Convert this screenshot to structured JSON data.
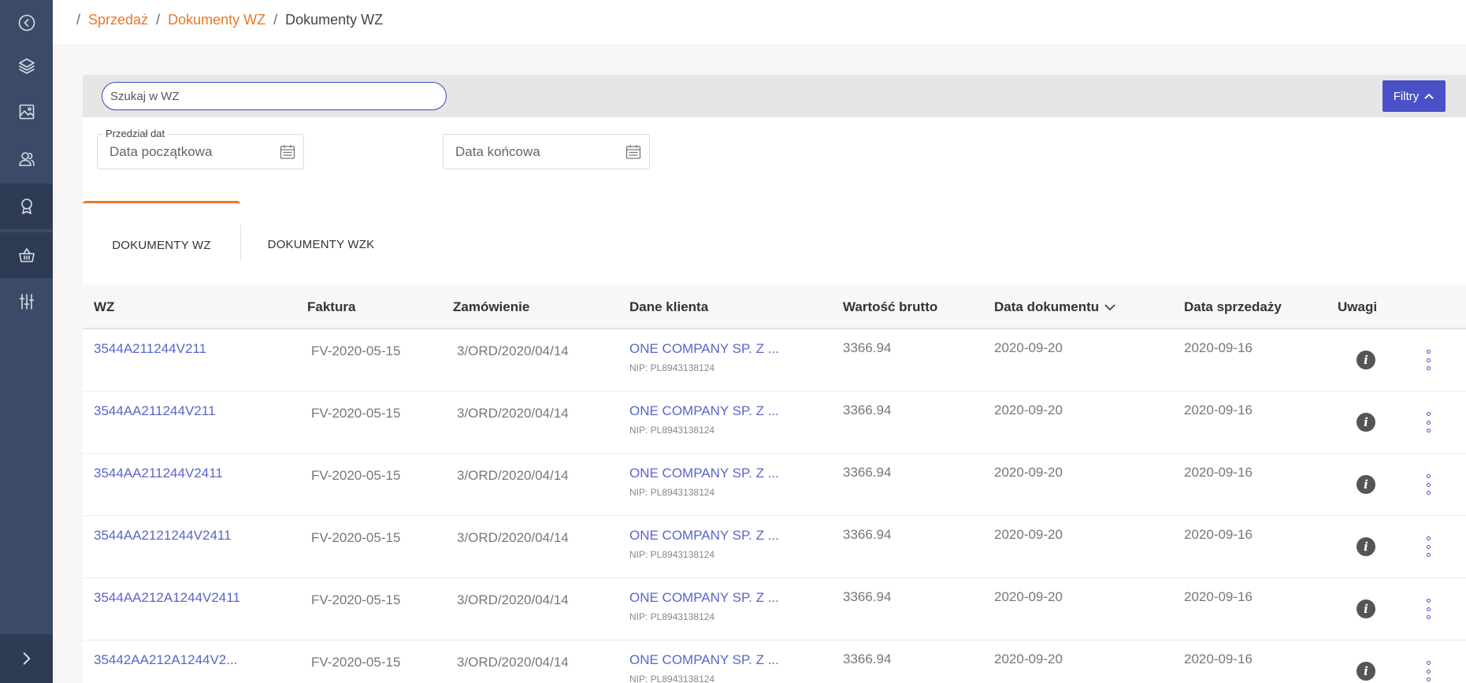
{
  "sidebar": {
    "items": [
      {
        "icon": "back-circle-icon"
      },
      {
        "icon": "layers-icon"
      },
      {
        "icon": "image-icon"
      },
      {
        "icon": "users-icon"
      },
      {
        "icon": "award-icon"
      },
      {
        "icon": "basket-icon"
      },
      {
        "icon": "sliders-icon"
      }
    ],
    "expand_icon": "chevron-right-icon"
  },
  "breadcrumb": {
    "items": [
      "Sprzedaż",
      "Dokumenty WZ",
      "Dokumenty WZ"
    ]
  },
  "search": {
    "placeholder": "Szukaj w WZ"
  },
  "filters": {
    "label": "Filtry"
  },
  "date_range": {
    "label": "Przedział dat",
    "start_placeholder": "Data początkowa",
    "end_placeholder": "Data końcowa"
  },
  "tabs": [
    {
      "label": "DOKUMENTY WZ",
      "active": true
    },
    {
      "label": "DOKUMENTY WZK",
      "active": false
    }
  ],
  "table": {
    "columns": [
      "WZ",
      "Faktura",
      "Zamówienie",
      "Dane klienta",
      "Wartość brutto",
      "Data dokumentu",
      "Data sprzedaży",
      "Uwagi"
    ],
    "rows": [
      {
        "wz": "3544A211244V211",
        "faktura": "FV-2020-05-15",
        "zamowienie": "3/ORD/2020/04/14",
        "klient": "ONE COMPANY SP. Z ...",
        "nip": "NIP: PL8943138124",
        "brutto": "3366.94",
        "data_dok": "2020-09-20",
        "data_sprz": "2020-09-16"
      },
      {
        "wz": "3544AA211244V211",
        "faktura": "FV-2020-05-15",
        "zamowienie": "3/ORD/2020/04/14",
        "klient": "ONE COMPANY SP. Z ...",
        "nip": "NIP: PL8943138124",
        "brutto": "3366.94",
        "data_dok": "2020-09-20",
        "data_sprz": "2020-09-16"
      },
      {
        "wz": "3544AA211244V2411",
        "faktura": "FV-2020-05-15",
        "zamowienie": "3/ORD/2020/04/14",
        "klient": "ONE COMPANY SP. Z ...",
        "nip": "NIP: PL8943138124",
        "brutto": "3366.94",
        "data_dok": "2020-09-20",
        "data_sprz": "2020-09-16"
      },
      {
        "wz": "3544AA2121244V2411",
        "faktura": "FV-2020-05-15",
        "zamowienie": "3/ORD/2020/04/14",
        "klient": "ONE COMPANY SP. Z ...",
        "nip": "NIP: PL8943138124",
        "brutto": "3366.94",
        "data_dok": "2020-09-20",
        "data_sprz": "2020-09-16"
      },
      {
        "wz": "3544AA212A1244V2411",
        "faktura": "FV-2020-05-15",
        "zamowienie": "3/ORD/2020/04/14",
        "klient": "ONE COMPANY SP. Z ...",
        "nip": "NIP: PL8943138124",
        "brutto": "3366.94",
        "data_dok": "2020-09-20",
        "data_sprz": "2020-09-16"
      },
      {
        "wz": "35442AA212A1244V2...",
        "faktura": "FV-2020-05-15",
        "zamowienie": "3/ORD/2020/04/14",
        "klient": "ONE COMPANY SP. Z ...",
        "nip": "NIP: PL8943138124",
        "brutto": "3366.94",
        "data_dok": "2020-09-20",
        "data_sprz": "2020-09-16"
      }
    ]
  },
  "colors": {
    "sidebar": "#3b4a66",
    "accent": "#e8782b",
    "primary": "#4a50c8",
    "link": "#5a66c8"
  }
}
